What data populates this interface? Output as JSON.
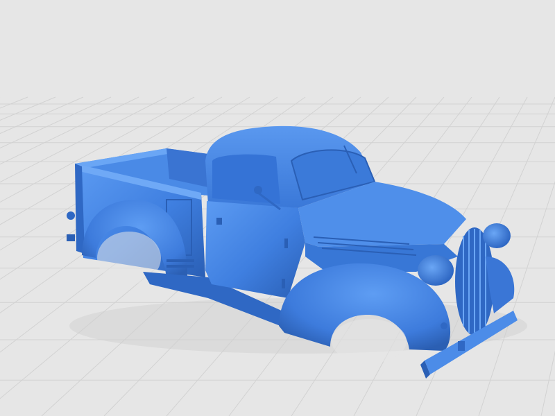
{
  "scene": {
    "subject": "truck-model",
    "colors": {
      "background": "#e6e6e6",
      "grid_line": "#d2d2d2",
      "body": "#3f7fe0",
      "body_light": "#5c9bf2",
      "body_dark": "#2a5fb5",
      "body_shadow": "#22509c"
    }
  }
}
